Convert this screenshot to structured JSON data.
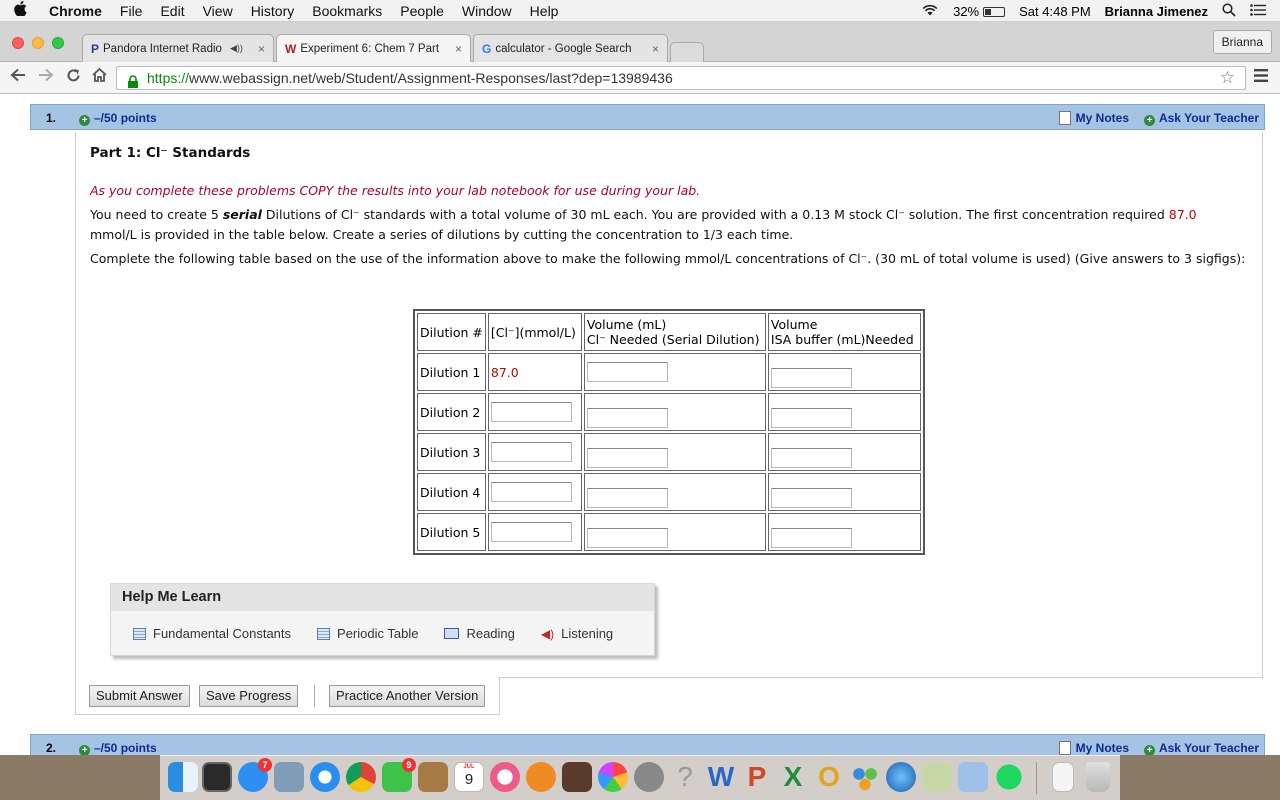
{
  "menubar": {
    "apple": "",
    "app": "Chrome",
    "items": [
      "File",
      "Edit",
      "View",
      "History",
      "Bookmarks",
      "People",
      "Window",
      "Help"
    ],
    "battery": "32%",
    "clock": "Sat 4:48 PM",
    "user": "Brianna Jimenez"
  },
  "tabs": [
    {
      "icon": "P",
      "label": "Pandora Internet Radio",
      "audio": "◀))",
      "close": "×"
    },
    {
      "icon": "W",
      "label": "Experiment 6: Chem 7 Part",
      "close": "×"
    },
    {
      "icon": "G",
      "label": "calculator - Google Search",
      "close": "×"
    }
  ],
  "profile": "Brianna",
  "address": {
    "scheme": "https://",
    "rest": "www.webassign.net/web/Student/Assignment-Responses/last?dep=13989436"
  },
  "question1": {
    "number": "1.",
    "points": "–/50 points",
    "notes": "My Notes",
    "ask": "Ask Your Teacher"
  },
  "content": {
    "part_title": "Part 1: Cl⁻ Standards",
    "instruction": "As you complete these problems COPY the results into your lab notebook for use during your lab.",
    "para1_a": "You need to create 5 ",
    "para1_serial": "serial",
    "para1_b": " Dilutions of Cl⁻ standards with a total volume of 30 mL each. You are provided with a 0.13 M stock Cl⁻ solution. The first concentration required ",
    "para1_value": "87.0",
    "para1_c": " mmol/L is provided in the table below. Create a series of dilutions by cutting the concentration to 1/3 each time.",
    "para2": "Complete the following table based on the use of the information above to make the following mmol/L concentrations of Cl⁻. (30 mL of total volume is used) (Give answers to 3 sigfigs):"
  },
  "table": {
    "headers": {
      "dilution": "Dilution #",
      "conc": "[Cl⁻](mmol/L)",
      "vol_line1": "Volume (mL)",
      "vol_line2": "Cl⁻ Needed (Serial Dilution)",
      "isa_line1": "Volume",
      "isa_line2": "ISA buffer (mL)Needed"
    },
    "rows": [
      {
        "label": "Dilution 1",
        "conc": "87.0"
      },
      {
        "label": "Dilution 2",
        "conc": ""
      },
      {
        "label": "Dilution 3",
        "conc": ""
      },
      {
        "label": "Dilution 4",
        "conc": ""
      },
      {
        "label": "Dilution 5",
        "conc": ""
      }
    ]
  },
  "help": {
    "title": "Help Me Learn",
    "items": [
      "Fundamental Constants",
      "Periodic Table",
      "Reading",
      "Listening"
    ]
  },
  "buttons": {
    "submit": "Submit Answer",
    "save": "Save Progress",
    "practice": "Practice Another Version"
  },
  "question2": {
    "number": "2.",
    "points": "–/50 points",
    "notes": "My Notes",
    "ask": "Ask Your Teacher"
  },
  "dock": {
    "appstore_badge": "7",
    "facetime_badge": "9",
    "calendar_month": "JUL",
    "calendar_day": "9"
  }
}
